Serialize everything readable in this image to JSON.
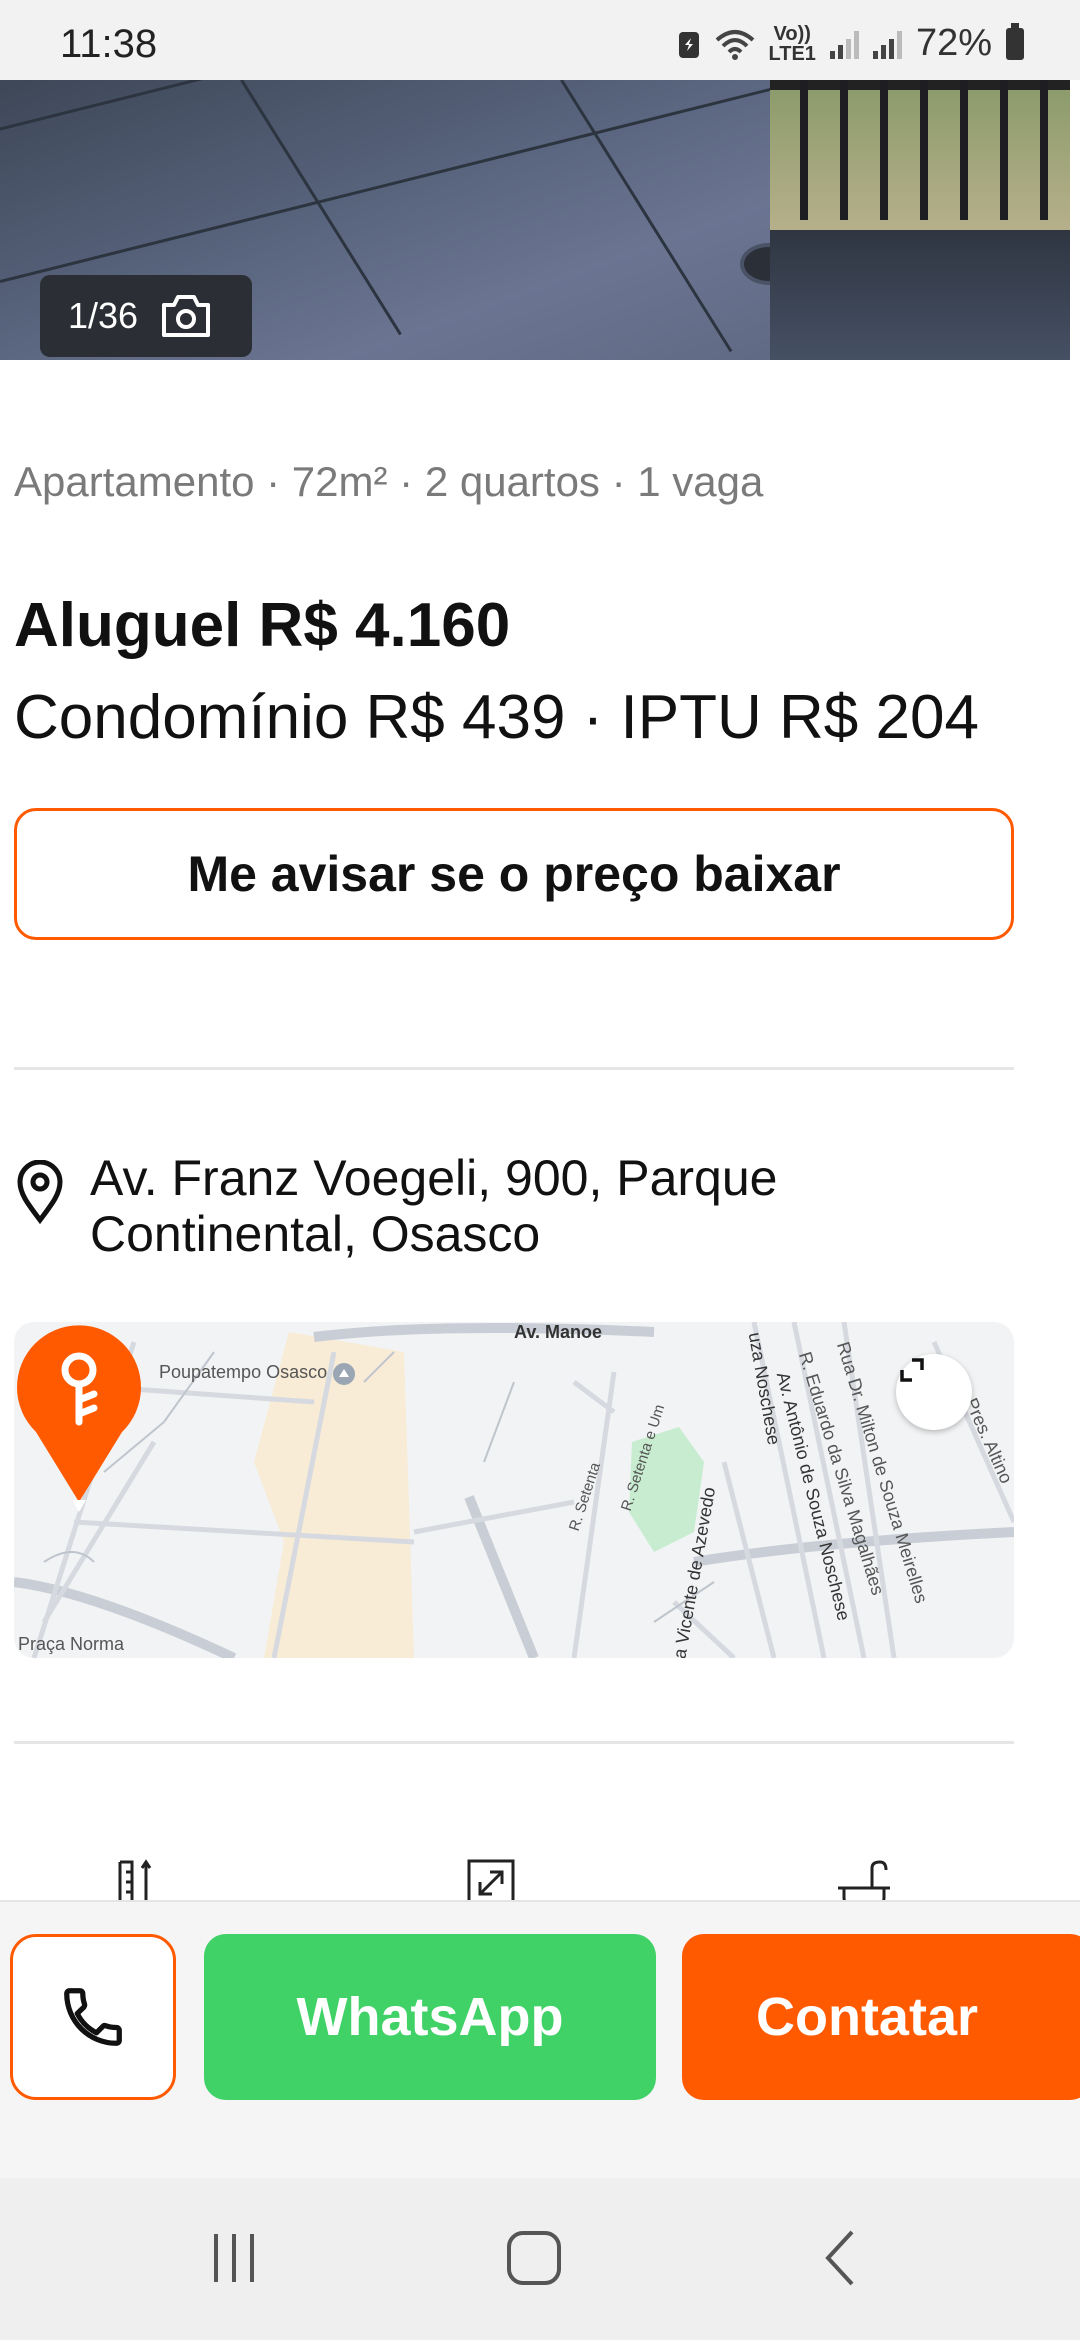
{
  "status_bar": {
    "time": "11:38",
    "battery": "72%",
    "volte_label": "Vo))",
    "lte_label": "LTE1",
    "icons": [
      "battery-saver-icon",
      "wifi-icon",
      "signal-icon",
      "signal-icon",
      "battery-icon"
    ]
  },
  "gallery": {
    "counter": "1/36",
    "icon": "camera-icon"
  },
  "listing": {
    "summary": "Apartamento · 72m² · 2 quartos · 1 vaga",
    "rent": "Aluguel R$ 4.160",
    "fees": "Condomínio R$ 439 · IPTU R$ 204",
    "price_alert_button": "Me avisar se o preço baixar"
  },
  "address": {
    "icon": "location-pin-icon",
    "line1": "Av. Franz Voegeli, 900, Parque",
    "line2": "Continental, Osasco"
  },
  "map": {
    "labels": {
      "poupatempo": "Poupatempo Osasco",
      "av_manoel": "Av. Manoe",
      "praca_norma": "Praça Norma",
      "r_setenta": "R. Setenta",
      "r_setenta_um": "R. Setenta e Um",
      "vicente": "la Vicente de Azevedo",
      "noschese": "uza Noschese",
      "antonio": "Av. Antônio de Souza Noschese",
      "eduardo": "R. Eduardo da Silva Magalhães",
      "milton": "Rua Dr. Milton de Souza Meirelles",
      "altino": "Av. Pres. Altino"
    },
    "expand_icon": "expand-icon",
    "pin_icon": "key-pin-icon"
  },
  "features_icons": [
    "area-icon",
    "expand-area-icon",
    "bathtub-icon"
  ],
  "actions": {
    "call_icon": "phone-icon",
    "whatsapp": "WhatsApp",
    "contact": "Contatar"
  },
  "nav": {
    "recents_icon": "recents-icon",
    "home_icon": "home-icon",
    "back_icon": "back-icon"
  },
  "colors": {
    "accent": "#ff5a00",
    "whatsapp": "#40d167"
  }
}
